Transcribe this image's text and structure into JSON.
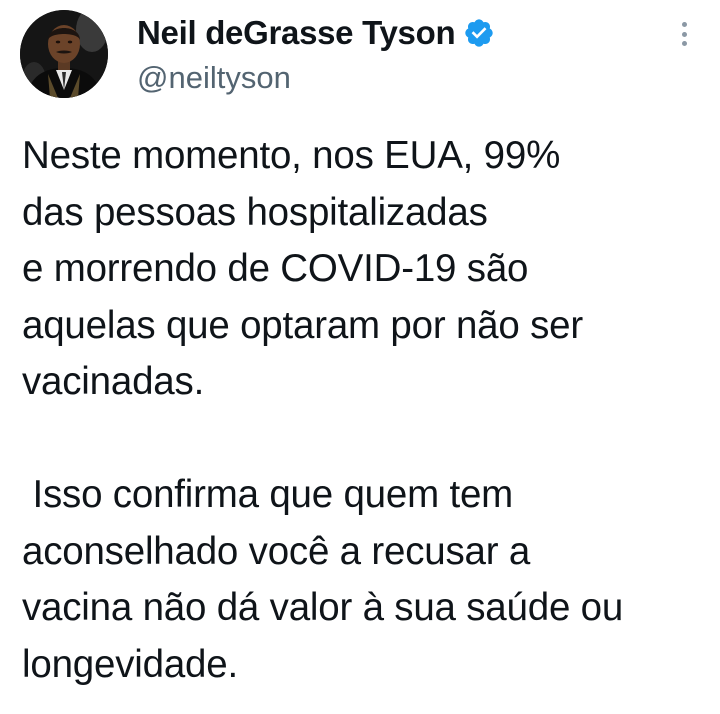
{
  "author": {
    "display_name": "Neil deGrasse Tyson",
    "handle": "@neiltyson",
    "verified": true,
    "avatar_icon": "profile-photo",
    "verified_icon": "verified-badge-icon",
    "verified_color": "#1d9bf0"
  },
  "menu": {
    "icon": "more-options-icon"
  },
  "tweet": {
    "paragraph1": [
      "Neste momento, nos EUA, 99%",
      "das pessoas hospitalizadas",
      "e morrendo de COVID-19 são",
      "aquelas que optaram por não ser",
      "vacinadas."
    ],
    "paragraph2": [
      " Isso confirma que quem tem",
      "aconselhado você a recusar a",
      "vacina não dá valor à sua saúde ou",
      "longevidade."
    ]
  },
  "colors": {
    "text": "#0f1419",
    "secondary": "#536471",
    "background": "#ffffff"
  }
}
